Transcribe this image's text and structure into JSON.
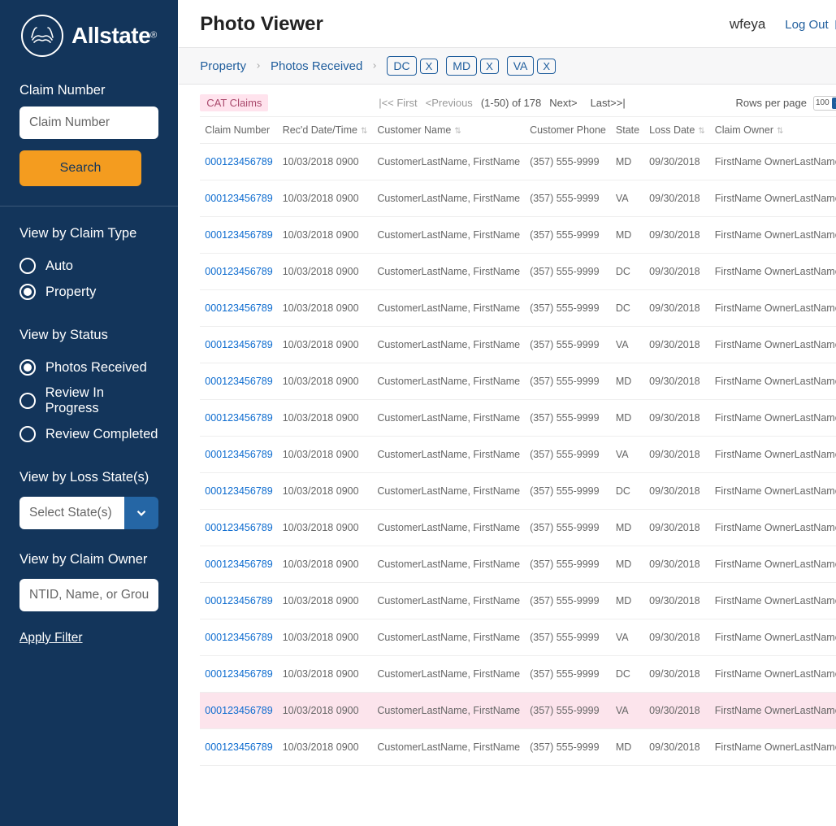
{
  "brand": {
    "name": "Allstate"
  },
  "sidebar": {
    "claim_number_label": "Claim Number",
    "claim_number_placeholder": "Claim Number",
    "search_label": "Search",
    "claim_type": {
      "title": "View by Claim Type",
      "o1": "Auto",
      "o2": "Property",
      "selected": "Property"
    },
    "status": {
      "title": "View by Status",
      "o1": "Photos Received",
      "o2": "Review In Progress",
      "o3": "Review Completed",
      "selected": "Photos Received"
    },
    "loss_state": {
      "title": "View by Loss State(s)",
      "placeholder": "Select State(s)"
    },
    "claim_owner": {
      "title": "View by Claim Owner",
      "placeholder": "NTID, Name, or Group"
    },
    "apply_filter": "Apply Filter"
  },
  "header": {
    "title": "Photo Viewer",
    "username": "wfeya",
    "logout": "Log Out"
  },
  "breadcrumb": {
    "b1": "Property",
    "b2": "Photos Received",
    "chips": {
      "c1": "DC",
      "c2": "MD",
      "c3": "VA",
      "x": "X"
    }
  },
  "table_meta": {
    "cat_badge": "CAT Claims",
    "first": "|<< First",
    "prev": "<Previous",
    "range": "(1-50) of 178",
    "next": "Next>",
    "last": "Last>>|",
    "rpp_label": "Rows per page",
    "rpp_value": "100"
  },
  "columns": {
    "c1": "Claim Number",
    "c2": "Rec'd Date/Time",
    "c3": "Customer Name",
    "c4": "Customer Phone",
    "c5": "State",
    "c6": "Loss Date",
    "c7": "Claim Owner"
  },
  "rows": [
    {
      "claim": "000123456789",
      "dt": "10/03/2018 0900",
      "name": "CustomerLastName, FirstName",
      "phone": "(357) 555-9999",
      "st": "MD",
      "loss": "09/30/2018",
      "owner": "FirstName OwnerLastName",
      "hl": false
    },
    {
      "claim": "000123456789",
      "dt": "10/03/2018 0900",
      "name": "CustomerLastName, FirstName",
      "phone": "(357) 555-9999",
      "st": "VA",
      "loss": "09/30/2018",
      "owner": "FirstName OwnerLastName",
      "hl": false
    },
    {
      "claim": "000123456789",
      "dt": "10/03/2018 0900",
      "name": "CustomerLastName, FirstName",
      "phone": "(357) 555-9999",
      "st": "MD",
      "loss": "09/30/2018",
      "owner": "FirstName OwnerLastName",
      "hl": false
    },
    {
      "claim": "000123456789",
      "dt": "10/03/2018 0900",
      "name": "CustomerLastName, FirstName",
      "phone": "(357) 555-9999",
      "st": "DC",
      "loss": "09/30/2018",
      "owner": "FirstName OwnerLastName",
      "hl": false
    },
    {
      "claim": "000123456789",
      "dt": "10/03/2018 0900",
      "name": "CustomerLastName, FirstName",
      "phone": "(357) 555-9999",
      "st": "DC",
      "loss": "09/30/2018",
      "owner": "FirstName OwnerLastName",
      "hl": false
    },
    {
      "claim": "000123456789",
      "dt": "10/03/2018 0900",
      "name": "CustomerLastName, FirstName",
      "phone": "(357) 555-9999",
      "st": "VA",
      "loss": "09/30/2018",
      "owner": "FirstName OwnerLastName",
      "hl": false
    },
    {
      "claim": "000123456789",
      "dt": "10/03/2018 0900",
      "name": "CustomerLastName, FirstName",
      "phone": "(357) 555-9999",
      "st": "MD",
      "loss": "09/30/2018",
      "owner": "FirstName OwnerLastName",
      "hl": false
    },
    {
      "claim": "000123456789",
      "dt": "10/03/2018 0900",
      "name": "CustomerLastName, FirstName",
      "phone": "(357) 555-9999",
      "st": "MD",
      "loss": "09/30/2018",
      "owner": "FirstName OwnerLastName",
      "hl": false
    },
    {
      "claim": "000123456789",
      "dt": "10/03/2018 0900",
      "name": "CustomerLastName, FirstName",
      "phone": "(357) 555-9999",
      "st": "VA",
      "loss": "09/30/2018",
      "owner": "FirstName OwnerLastName",
      "hl": false
    },
    {
      "claim": "000123456789",
      "dt": "10/03/2018 0900",
      "name": "CustomerLastName, FirstName",
      "phone": "(357) 555-9999",
      "st": "DC",
      "loss": "09/30/2018",
      "owner": "FirstName OwnerLastName",
      "hl": false
    },
    {
      "claim": "000123456789",
      "dt": "10/03/2018 0900",
      "name": "CustomerLastName, FirstName",
      "phone": "(357) 555-9999",
      "st": "MD",
      "loss": "09/30/2018",
      "owner": "FirstName OwnerLastName",
      "hl": false
    },
    {
      "claim": "000123456789",
      "dt": "10/03/2018 0900",
      "name": "CustomerLastName, FirstName",
      "phone": "(357) 555-9999",
      "st": "MD",
      "loss": "09/30/2018",
      "owner": "FirstName OwnerLastName",
      "hl": false
    },
    {
      "claim": "000123456789",
      "dt": "10/03/2018 0900",
      "name": "CustomerLastName, FirstName",
      "phone": "(357) 555-9999",
      "st": "MD",
      "loss": "09/30/2018",
      "owner": "FirstName OwnerLastName",
      "hl": false
    },
    {
      "claim": "000123456789",
      "dt": "10/03/2018 0900",
      "name": "CustomerLastName, FirstName",
      "phone": "(357) 555-9999",
      "st": "VA",
      "loss": "09/30/2018",
      "owner": "FirstName OwnerLastName",
      "hl": false
    },
    {
      "claim": "000123456789",
      "dt": "10/03/2018 0900",
      "name": "CustomerLastName, FirstName",
      "phone": "(357) 555-9999",
      "st": "DC",
      "loss": "09/30/2018",
      "owner": "FirstName OwnerLastName",
      "hl": false
    },
    {
      "claim": "000123456789",
      "dt": "10/03/2018 0900",
      "name": "CustomerLastName, FirstName",
      "phone": "(357) 555-9999",
      "st": "VA",
      "loss": "09/30/2018",
      "owner": "FirstName OwnerLastName",
      "hl": true
    },
    {
      "claim": "000123456789",
      "dt": "10/03/2018 0900",
      "name": "CustomerLastName, FirstName",
      "phone": "(357) 555-9999",
      "st": "MD",
      "loss": "09/30/2018",
      "owner": "FirstName OwnerLastName",
      "hl": false
    }
  ]
}
